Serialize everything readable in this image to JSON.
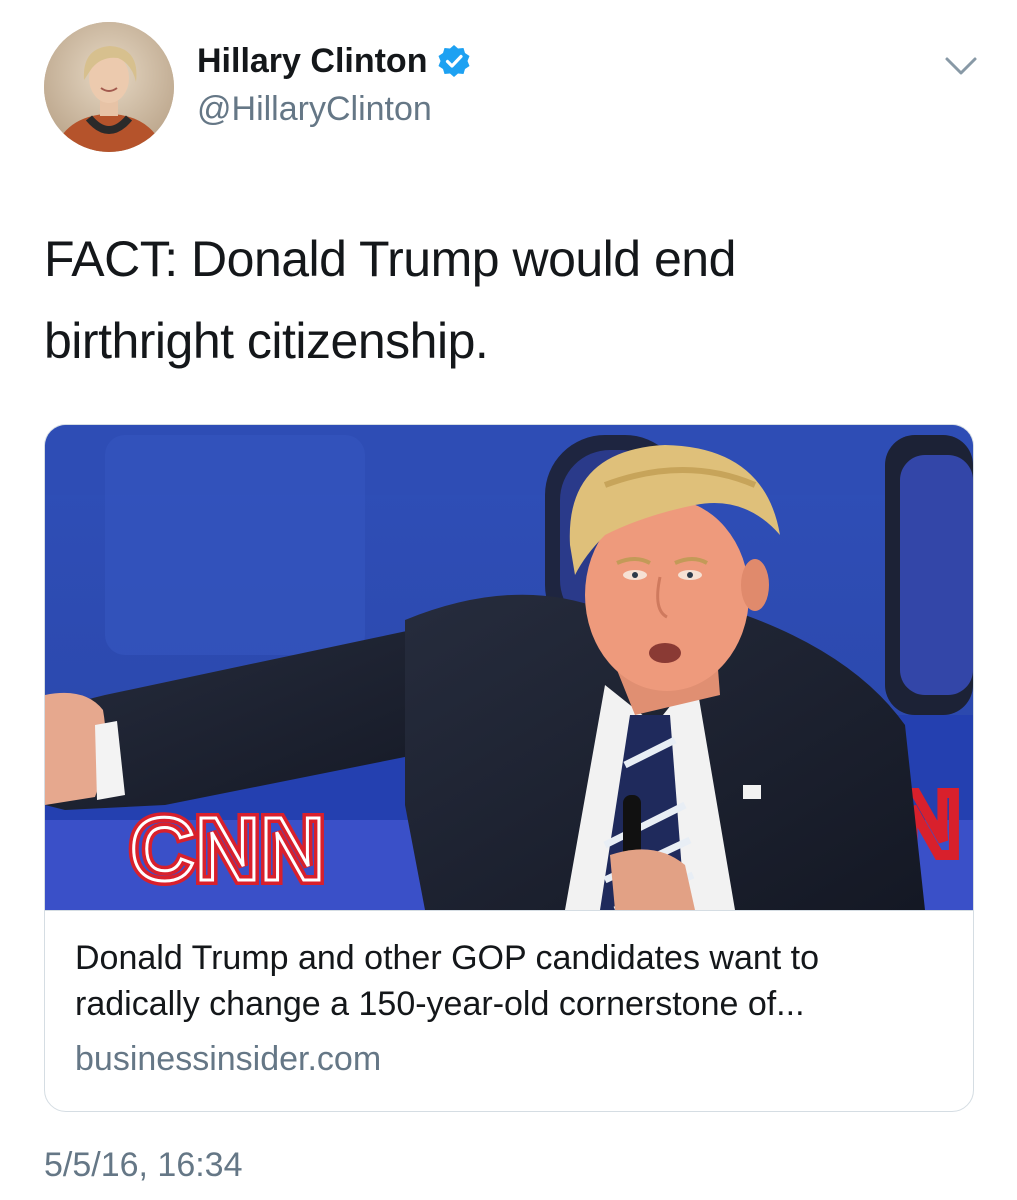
{
  "author": {
    "display_name": "Hillary Clinton",
    "handle": "@HillaryClinton",
    "verified": true
  },
  "icons": {
    "verified": "verified-badge-icon",
    "menu": "chevron-down-icon"
  },
  "tweet": {
    "text_line1": "FACT: Donald Trump would end",
    "text_line2": "birthright citizenship."
  },
  "card": {
    "title_line1": "Donald Trump and other GOP candidates want to",
    "title_line2": "radically change a 150-year-old cornerstone of...",
    "domain": "businessinsider.com"
  },
  "timestamp": "5/5/16, 16:34",
  "colors": {
    "verified_blue": "#1da1f2",
    "secondary_text": "#657786",
    "primary_text": "#14171a",
    "card_border": "#d5dde3"
  }
}
